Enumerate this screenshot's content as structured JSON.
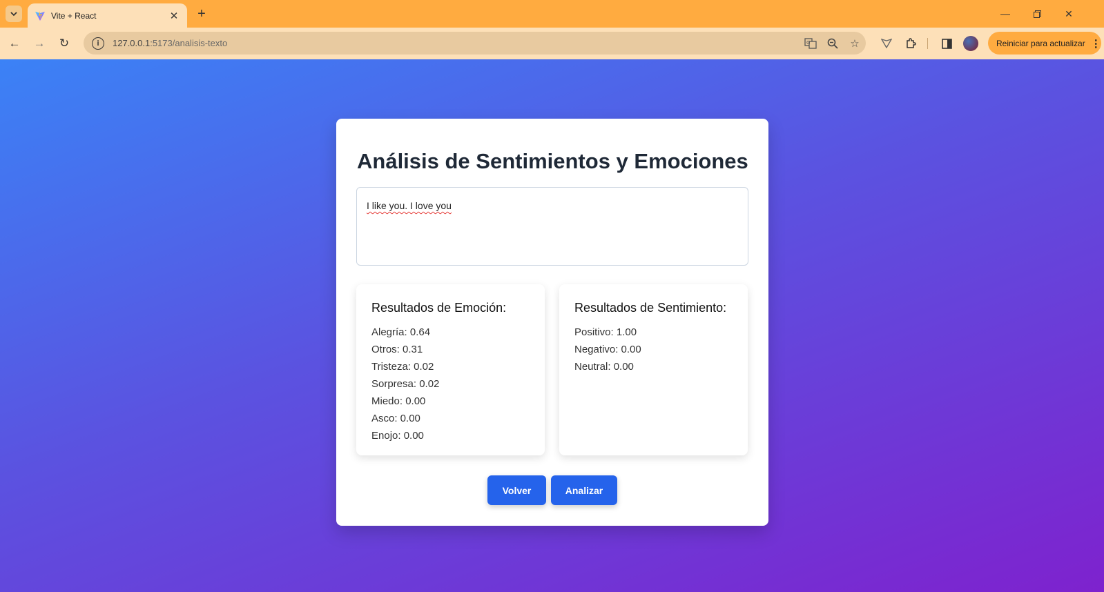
{
  "browser": {
    "tab_title": "Vite + React",
    "url_host": "127.0.0.1",
    "url_path": ":5173/analisis-texto",
    "restart_label": "Reiniciar para actualizar"
  },
  "page": {
    "title": "Análisis de Sentimientos y Emociones",
    "input_text": "I like you. I love you",
    "emotion_panel": {
      "title": "Resultados de Emoción:",
      "rows": [
        "Alegría: 0.64",
        "Otros: 0.31",
        "Tristeza: 0.02",
        "Sorpresa: 0.02",
        "Miedo: 0.00",
        "Asco: 0.00",
        "Enojo: 0.00"
      ]
    },
    "sentiment_panel": {
      "title": "Resultados de Sentimiento:",
      "rows": [
        "Positivo: 1.00",
        "Negativo: 0.00",
        "Neutral: 0.00"
      ]
    },
    "back_button": "Volver",
    "analyze_button": "Analizar"
  },
  "colors": {
    "gradient_start": "#3b82f6",
    "gradient_end": "#7e22ce",
    "button": "#2563eb",
    "browser_frame": "#ffab40"
  }
}
